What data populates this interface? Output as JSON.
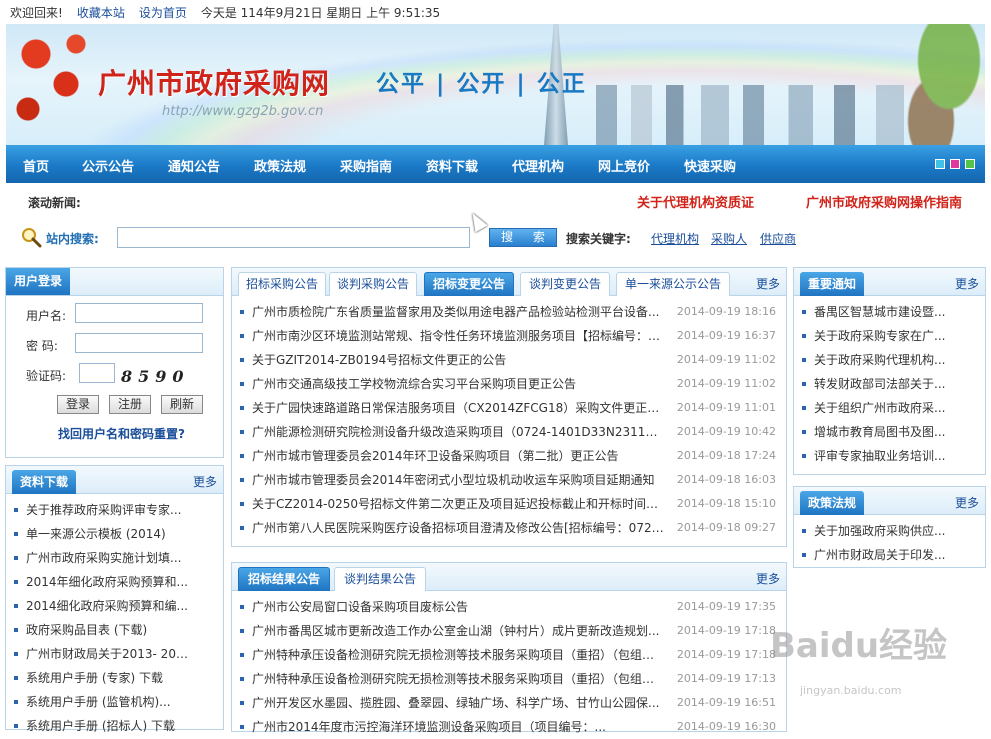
{
  "topbar": {
    "welcome": "欢迎回来!",
    "bookmark": "收藏本站",
    "homepage": "设为首页",
    "today": "今天是 114年9月21日 星期日 上午 9:51:35"
  },
  "banner": {
    "title": "广州市政府采购网",
    "url": "http://www.gzg2b.gov.cn",
    "slogan": "公平 | 公开 | 公正"
  },
  "nav": {
    "items": [
      "首页",
      "公示公告",
      "通知公告",
      "政策法规",
      "采购指南",
      "资料下载",
      "代理机构",
      "网上竞价",
      "快速采购"
    ],
    "dot_colors": [
      "#3fc2e6",
      "#e0399c",
      "#55c34a"
    ]
  },
  "news": {
    "label": "滚动新闻:",
    "items": [
      "关于代理机构资质证",
      "广州市政府采购网操作指南"
    ]
  },
  "search": {
    "label": "站内搜索:",
    "button": "搜  索",
    "kw_label": "搜索关键字:",
    "keywords": [
      "代理机构",
      "采购人",
      "供应商"
    ]
  },
  "login": {
    "title": "用户登录",
    "username_label": "用户名:",
    "password_label": "密  码:",
    "captcha_label": "验证码:",
    "captcha_text": "8590",
    "login_btn": "登录",
    "register_btn": "注册",
    "refresh_btn": "刷新",
    "forgot": "找回用户名和密码重置?"
  },
  "downloads": {
    "title": "资料下载",
    "more": "更多",
    "items": [
      "关于推荐政府采购评审专家...",
      "单一来源公示模板 (2014)",
      "广州市政府采购实施计划填...",
      "2014年细化政府采购预算和...",
      "2014细化政府采购预算和编...",
      "政府采购品目表 (下载)",
      "广州市财政局关于2013- 201...",
      "系统用户手册 (专家) 下载",
      "系统用户手册 (监管机构)...",
      "系统用户手册 (招标人) 下载"
    ]
  },
  "notices": {
    "tabs": [
      "招标采购公告",
      "谈判采购公告",
      "招标变更公告",
      "谈判变更公告",
      "单一来源公示公告"
    ],
    "active_tab": 2,
    "more": "更多",
    "items": [
      {
        "title": "广州市质检院广东省质量监督家用及类似用途电器产品检验站检测平台设备...",
        "date": "2014-09-19 18:16"
      },
      {
        "title": "广州市南沙区环境监测站常规、指令性任务环境监测服务项目【招标编号：C...",
        "date": "2014-09-19 16:37"
      },
      {
        "title": "关于GZIT2014-ZB0194号招标文件更正的公告",
        "date": "2014-09-19 11:02"
      },
      {
        "title": "广州市交通高级技工学校物流综合实习平台采购项目更正公告",
        "date": "2014-09-19 11:02"
      },
      {
        "title": "关于广园快速路道路日常保洁服务项目（CX2014ZFCG18）采购文件更正的公告",
        "date": "2014-09-19 11:01"
      },
      {
        "title": "广州能源检测研究院检测设备升级改造采购项目（0724-1401D33N2311）更正...",
        "date": "2014-09-19 10:42"
      },
      {
        "title": "广州市城市管理委员会2014年环卫设备采购项目（第二批）更正公告",
        "date": "2014-09-18 17:24"
      },
      {
        "title": "广州市城市管理委员会2014年密闭式小型垃圾机动收运车采购项目延期通知",
        "date": "2014-09-18 16:03"
      },
      {
        "title": "关于CZ2014-0250号招标文件第二次更正及项目延迟投标截止和开标时间的通知",
        "date": "2014-09-18 15:10"
      },
      {
        "title": "广州市第八人民医院采购医疗设备招标项目澄清及修改公告[招标编号：0724...",
        "date": "2014-09-18 09:27"
      }
    ]
  },
  "results": {
    "tabs": [
      "招标结果公告",
      "谈判结果公告"
    ],
    "active_tab": 0,
    "more": "更多",
    "items": [
      {
        "title": "广州市公安局窗口设备采购项目废标公告",
        "date": "2014-09-19 17:35"
      },
      {
        "title": "广州市番禺区城市更新改造工作办公室金山湖（钟村片）成片更新改造规划...",
        "date": "2014-09-19 17:18"
      },
      {
        "title": "广州特种承压设备检测研究院无损检测等技术服务采购项目（重招）（包组二）...",
        "date": "2014-09-19 17:18"
      },
      {
        "title": "广州特种承压设备检测研究院无损检测等技术服务采购项目（重招）（包组一...",
        "date": "2014-09-19 17:13"
      },
      {
        "title": "广州开发区水墨园、揽胜园、叠翠园、绿轴广场、科学广场、甘竹山公园保...",
        "date": "2014-09-19 16:51"
      },
      {
        "title": "广州市2014年度市污控海洋环境监测设备采购项目（项目编号：...",
        "date": "2014-09-19 16:30"
      }
    ]
  },
  "important": {
    "title": "重要通知",
    "more": "更多",
    "items": [
      "番禺区智慧城市建设暨...",
      "关于政府采购专家在广...",
      "关于政府采购代理机构...",
      "转发财政部司法部关于...",
      "关于组织广州市政府采...",
      "增城市教育局图书及图...",
      "评审专家抽取业务培训..."
    ]
  },
  "policy": {
    "title": "政策法规",
    "more": "更多",
    "items": [
      "关于加强政府采购供应...",
      "广州市财政局关于印发..."
    ]
  },
  "watermark": {
    "logo": "Baidu经验",
    "url": "jingyan.baidu.com"
  }
}
